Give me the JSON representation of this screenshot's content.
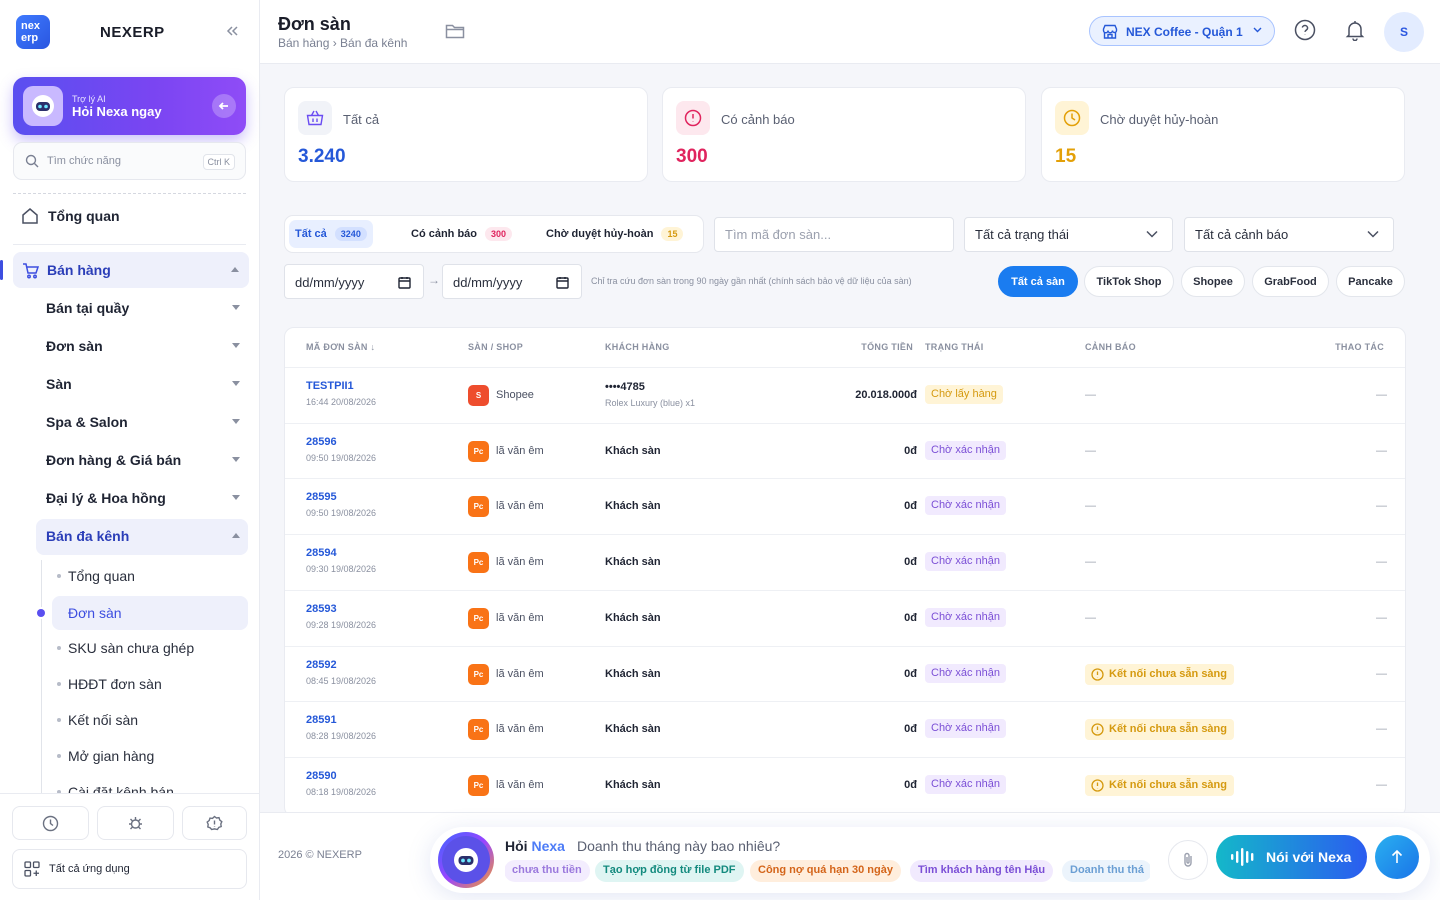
{
  "sidebar": {
    "brand": "NEXERP",
    "logo_text": "nex erp",
    "ai_card": {
      "small": "Trợ lý AI",
      "big": "Hỏi Nexa ngay"
    },
    "search_placeholder": "Tìm chức năng",
    "search_shortcut": "Ctrl K",
    "overview": "Tổng quan",
    "sales": "Bán hàng",
    "groups": [
      "Bán tại quầy",
      "Đơn sàn",
      "Sàn",
      "Spa & Salon",
      "Đơn hàng & Giá bán",
      "Đại lý & Hoa hồng",
      "Bán đa kênh"
    ],
    "leaves": [
      "Tổng quan",
      "Đơn sàn",
      "SKU sàn chưa ghép",
      "HĐĐT đơn sàn",
      "Kết nối sàn",
      "Mở gian hàng",
      "Cài đặt kênh bán"
    ],
    "all_apps": "Tất cả ứng dụng"
  },
  "header": {
    "title": "Đơn sàn",
    "breadcrumb": "Bán hàng › Bán đa kênh",
    "store": "NEX Coffee - Quận 1",
    "avatar": "S"
  },
  "stats": [
    {
      "label": "Tất cả",
      "value": "3.240",
      "color": "#2558d8"
    },
    {
      "label": "Có cảnh báo",
      "value": "300",
      "color": "#e0245e"
    },
    {
      "label": "Chờ duyệt hủy-hoàn",
      "value": "15",
      "color": "#e3a008"
    }
  ],
  "filters": {
    "tabs": [
      {
        "label": "Tất cả",
        "count": "3240"
      },
      {
        "label": "Có cảnh báo",
        "count": "300"
      },
      {
        "label": "Chờ duyệt hủy-hoàn",
        "count": "15"
      }
    ],
    "search_placeholder": "Tìm mã đơn sàn...",
    "status_select": "Tất cả trạng thái",
    "warning_select": "Tất cả cảnh báo",
    "date_from": "dd/mm/yyyy",
    "date_to": "dd/mm/yyyy",
    "date_arrow": "→",
    "note": "Chỉ tra cứu đơn sàn trong 90 ngày gần nhất (chính sách bảo vệ dữ liệu của sàn)",
    "channels": [
      "Tất cả sàn",
      "TikTok Shop",
      "Shopee",
      "GrabFood",
      "Pancake"
    ]
  },
  "table": {
    "columns": [
      "MÃ ĐƠN SÀN ↓",
      "SÀN / SHOP",
      "KHÁCH HÀNG",
      "TỔNG TIỀN",
      "TRẠNG THÁI",
      "CẢNH BÁO",
      "THAO TÁC"
    ],
    "rows": [
      {
        "id": "TESTPII1",
        "time": "16:44 20/08/2026",
        "badge": "S",
        "shop": "Shopee",
        "customer": "••••4785",
        "customer_sub": "Rolex Luxury (blue) x1",
        "total": "20.018.000đ",
        "status": "Chờ lấy hàng",
        "warning": "—",
        "action": "—"
      },
      {
        "id": "28596",
        "time": "09:50 19/08/2026",
        "badge": "Pc",
        "shop": "lã văn êm",
        "customer": "Khách sàn",
        "customer_sub": "",
        "total": "0đ",
        "status": "Chờ xác nhận",
        "warning": "—",
        "action": "—"
      },
      {
        "id": "28595",
        "time": "09:50 19/08/2026",
        "badge": "Pc",
        "shop": "lã văn êm",
        "customer": "Khách sàn",
        "customer_sub": "",
        "total": "0đ",
        "status": "Chờ xác nhận",
        "warning": "—",
        "action": "—"
      },
      {
        "id": "28594",
        "time": "09:30 19/08/2026",
        "badge": "Pc",
        "shop": "lã văn êm",
        "customer": "Khách sàn",
        "customer_sub": "",
        "total": "0đ",
        "status": "Chờ xác nhận",
        "warning": "—",
        "action": "—"
      },
      {
        "id": "28593",
        "time": "09:28 19/08/2026",
        "badge": "Pc",
        "shop": "lã văn êm",
        "customer": "Khách sàn",
        "customer_sub": "",
        "total": "0đ",
        "status": "Chờ xác nhận",
        "warning": "—",
        "action": "—"
      },
      {
        "id": "28592",
        "time": "08:45 19/08/2026",
        "badge": "Pc",
        "shop": "lã văn êm",
        "customer": "Khách sàn",
        "customer_sub": "",
        "total": "0đ",
        "status": "Chờ xác nhận",
        "warning": "Kết nối chưa sẵn sàng",
        "action": "—"
      },
      {
        "id": "28591",
        "time": "08:28 19/08/2026",
        "badge": "Pc",
        "shop": "lã văn êm",
        "customer": "Khách sàn",
        "customer_sub": "",
        "total": "0đ",
        "status": "Chờ xác nhận",
        "warning": "Kết nối chưa sẵn sàng",
        "action": "—"
      },
      {
        "id": "28590",
        "time": "08:18 19/08/2026",
        "badge": "Pc",
        "shop": "lã văn êm",
        "customer": "Khách sàn",
        "customer_sub": "",
        "total": "0đ",
        "status": "Chờ xác nhận",
        "warning": "Kết nối chưa sẵn sàng",
        "action": "—"
      }
    ]
  },
  "footer": {
    "copyright": "2026 © NEXERP",
    "ask_prefix": "Hỏi",
    "ask_brand": "Nexa",
    "question": "Doanh thu tháng này bao nhiêu?",
    "suggestions": [
      "chưa thu tiền",
      "Tạo hợp đồng từ file PDF",
      "Công nợ quá hạn 30 ngày",
      "Tìm khách hàng tên Hậu",
      "Doanh thu thá"
    ],
    "voice_button": "Nói với Nexa"
  },
  "colors": {
    "accent": "#2558d8",
    "primary_button": "#1a7cf0",
    "ai_purple": "#6a4cf2",
    "warning": "#d59a10",
    "danger": "#e0245e"
  }
}
